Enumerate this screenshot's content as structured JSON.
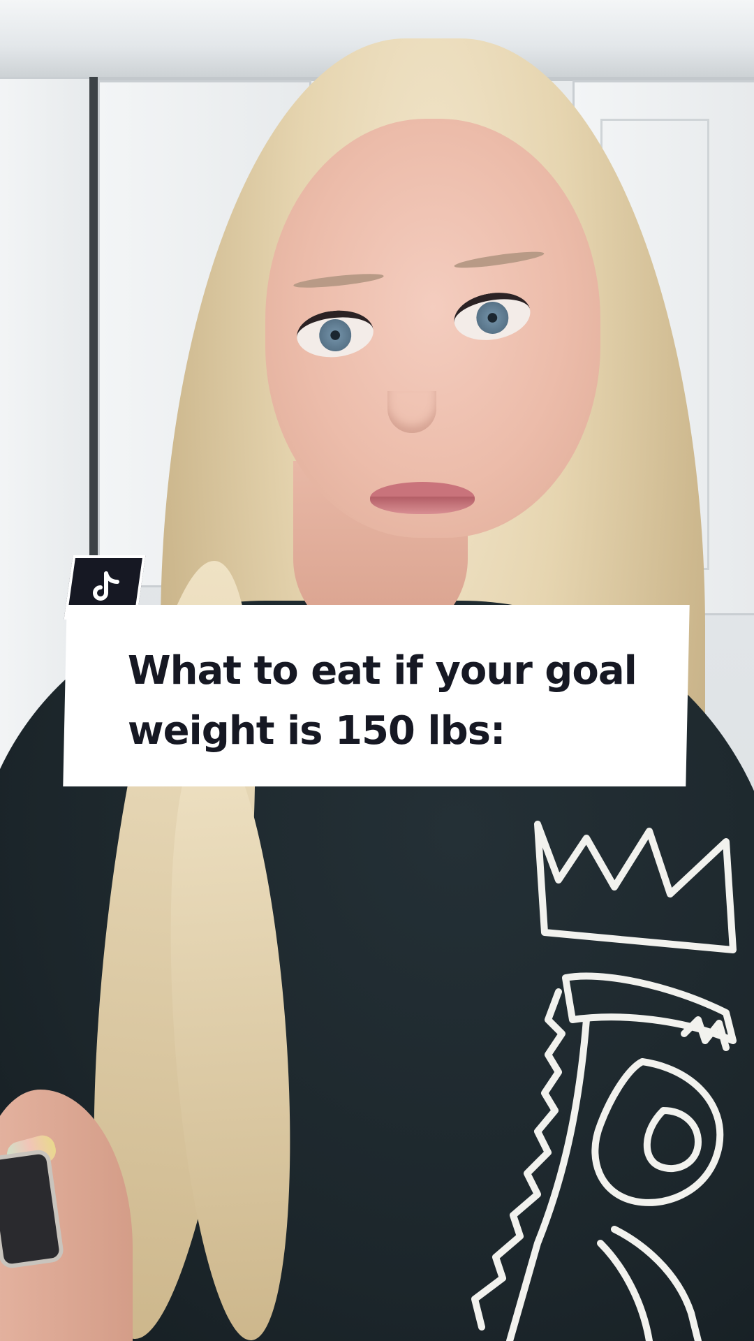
{
  "video": {
    "caption": "What to eat if your goal weight is 150 lbs:"
  },
  "branding": {
    "logo_icon": "tiktok-note-icon",
    "accent": "#161823",
    "card_color": "#ffffff"
  }
}
